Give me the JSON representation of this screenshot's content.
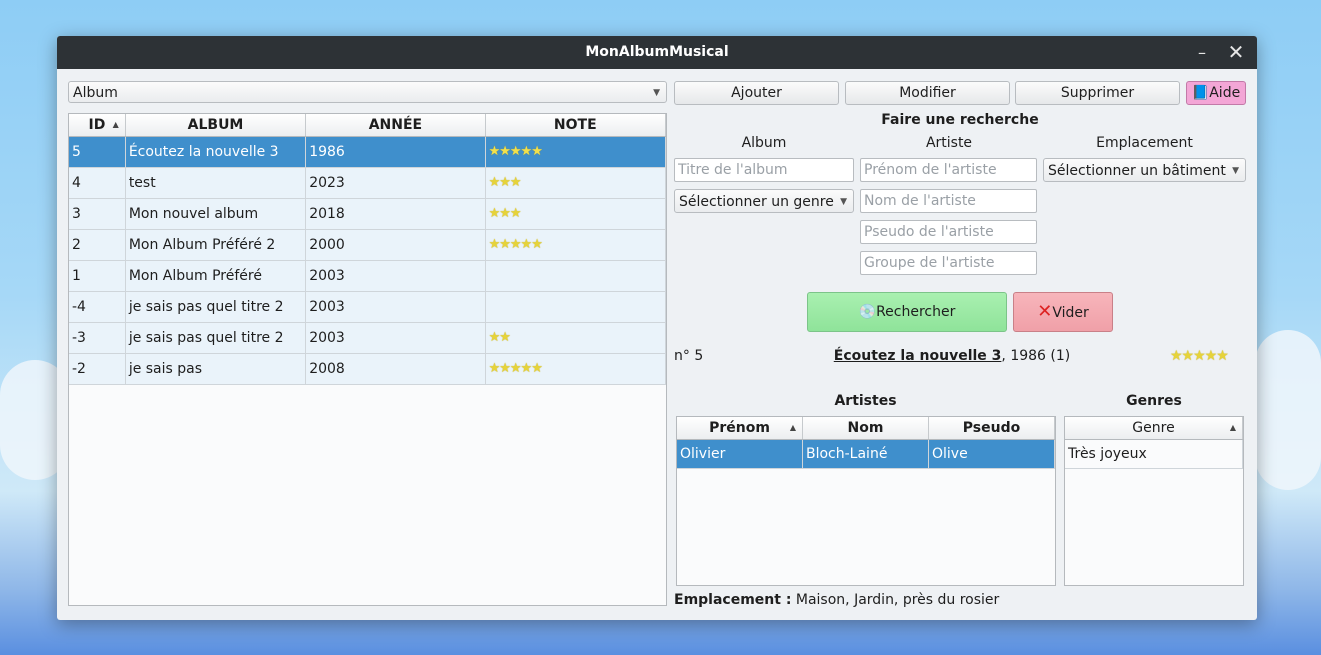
{
  "window": {
    "title": "MonAlbumMusical",
    "minimize_glyph": "–",
    "close_glyph": "✕"
  },
  "left": {
    "combo_value": "Album",
    "headers": [
      "ID",
      "ALBUM",
      "ANNÉE",
      "NOTE"
    ],
    "rows": [
      {
        "id": "5",
        "album": "Écoutez la nouvelle 3",
        "year": "1986",
        "stars": "★★★★★",
        "rating": 5
      },
      {
        "id": "4",
        "album": "test",
        "year": "2023",
        "stars": "★★★",
        "rating": 3
      },
      {
        "id": "3",
        "album": "Mon nouvel album",
        "year": "2018",
        "stars": "★★★",
        "rating": 3
      },
      {
        "id": "2",
        "album": "Mon Album Préféré 2",
        "year": "2000",
        "stars": "★★★★★",
        "rating": 5
      },
      {
        "id": "1",
        "album": "Mon Album Préféré",
        "year": "2003",
        "stars": "",
        "rating": 0
      },
      {
        "id": "-4",
        "album": "je sais pas quel titre 2",
        "year": "2003",
        "stars": "",
        "rating": 0
      },
      {
        "id": "-3",
        "album": "je sais pas quel titre 2",
        "year": "2003",
        "stars": "★★",
        "rating": 2
      },
      {
        "id": "-2",
        "album": "je sais pas",
        "year": "2008",
        "stars": "★★★★★",
        "rating": 5
      }
    ]
  },
  "toolbar": {
    "add": "Ajouter",
    "edit": "Modifier",
    "delete": "Supprimer",
    "help": "Aide",
    "help_icon": "book-icon"
  },
  "search": {
    "title": "Faire une recherche",
    "col_album": "Album",
    "col_artist": "Artiste",
    "col_location": "Emplacement",
    "album_title_placeholder": "Titre de l'album",
    "genre_select": "Sélectionner un genre",
    "artist_firstname_placeholder": "Prénom de l'artiste",
    "artist_lastname_placeholder": "Nom de l'artiste",
    "artist_pseudo_placeholder": "Pseudo de l'artiste",
    "artist_group_placeholder": "Groupe de l'artiste",
    "building_select": "Sélectionner un bâtiment",
    "search_button": "Rechercher",
    "search_icon": "cd-icon",
    "clear_button": "Vider",
    "clear_icon": "x-icon"
  },
  "detail": {
    "number": "n° 5",
    "album_title": "Écoutez la nouvelle 3",
    "album_suffix": ", 1986 (1)",
    "stars": "★★★★★",
    "rating": 5,
    "artists_title": "Artistes",
    "genres_title": "Genres",
    "artist_headers": [
      "Prénom",
      "Nom",
      "Pseudo"
    ],
    "artists": [
      {
        "firstname": "Olivier",
        "lastname": "Bloch-Lainé",
        "pseudo": "Olive"
      }
    ],
    "genre_header": "Genre",
    "genres": [
      "Très joyeux"
    ],
    "location_label": "Emplacement :",
    "location_value": " Maison, Jardin, près du rosier"
  },
  "colors": {
    "selection": "#3f8fcc",
    "titlebar": "#2d3236",
    "aide": "#f3a6d6",
    "search": "#a9f0b0",
    "clear": "#f7b5bb"
  }
}
